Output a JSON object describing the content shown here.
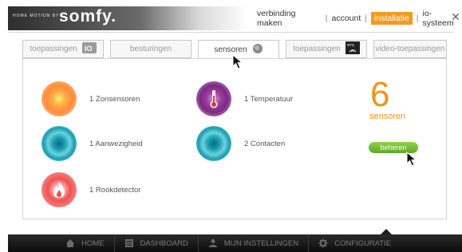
{
  "brand": {
    "tagline": "HOME MOTION BY",
    "name": "somfy."
  },
  "top_nav": {
    "items": [
      "verbinding maken",
      "account",
      "installatie",
      "io-systeem"
    ],
    "active": "installatie"
  },
  "tabs": [
    "toepassingen",
    "besturingen",
    "sensoren",
    "toepassingen",
    "video-toepassingen"
  ],
  "active_tab": "sensoren",
  "sensors": [
    {
      "label": "1 Zonsensoren",
      "icon": "sun-sensor-icon"
    },
    {
      "label": "1 Temperatuur",
      "icon": "thermometer-icon"
    },
    {
      "label": "1 Aanwezigheid",
      "icon": "presence-sensor-icon"
    },
    {
      "label": "2 Contacten",
      "icon": "contact-sensor-icon"
    },
    {
      "label": "1 Rookdetector",
      "icon": "smoke-detector-icon"
    }
  ],
  "summary": {
    "count": "6",
    "unit_label": "sensoren",
    "manage_button": "beheren"
  },
  "bottom_nav": {
    "items": [
      "HOME",
      "DASHBOARD",
      "MIJN INSTELLINGEN",
      "CONFIGURATIE"
    ]
  },
  "colors": {
    "accent_orange": "#f29b1e",
    "manage_green": "#6fb832",
    "bottom_bar": "#1a1a1a"
  }
}
